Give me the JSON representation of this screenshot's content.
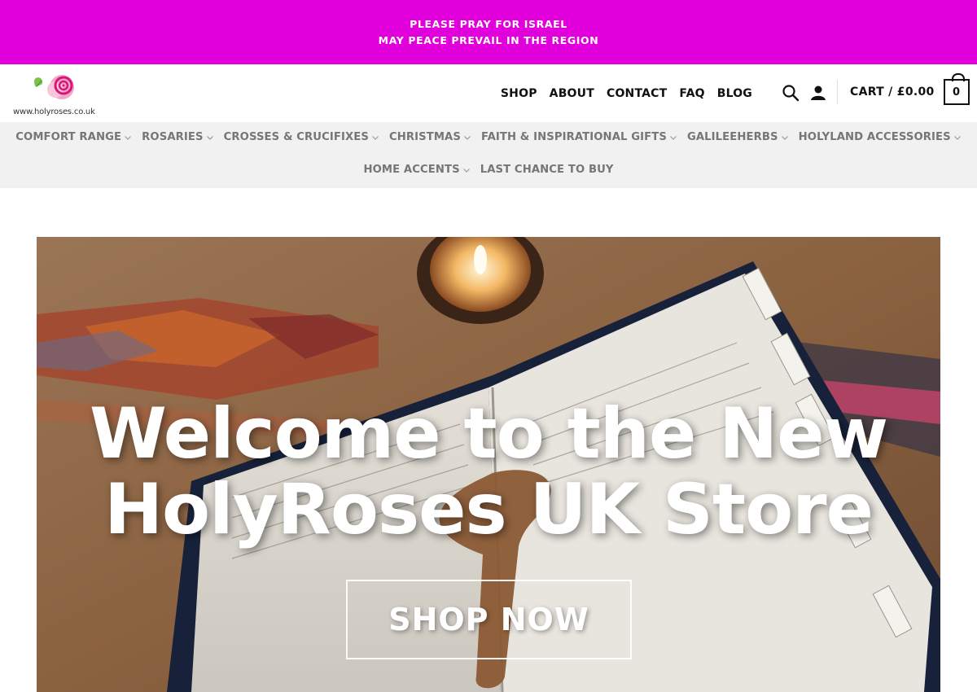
{
  "announcement": {
    "line1": "PLEASE PRAY FOR ISRAEL",
    "line2": "MAY PEACE PREVAIL IN THE REGION"
  },
  "logo": {
    "url_text": "www.holyroses.co.uk"
  },
  "main_nav": [
    {
      "label": "SHOP"
    },
    {
      "label": "ABOUT"
    },
    {
      "label": "CONTACT"
    },
    {
      "label": "FAQ"
    },
    {
      "label": "BLOG"
    }
  ],
  "header_icons": [
    "search-icon",
    "user-icon"
  ],
  "cart": {
    "label": "CART / £0.00",
    "count": "0"
  },
  "category_nav": {
    "row1": [
      {
        "label": "COMFORT RANGE"
      },
      {
        "label": "ROSARIES"
      },
      {
        "label": "CROSSES & CRUCIFIXES"
      },
      {
        "label": "CHRISTMAS"
      },
      {
        "label": "FAITH & INSPIRATIONAL GIFTS"
      },
      {
        "label": "GALILEEHERBS"
      },
      {
        "label": "HOLYLAND ACCESSORIES"
      }
    ],
    "row2": [
      {
        "label": "HOME ACCENTS",
        "dropdown": true
      },
      {
        "label": "LAST CHANCE TO BUY",
        "dropdown": false
      }
    ]
  },
  "hero": {
    "title_line1": "Welcome to the New",
    "title_line2": "HolyRoses UK Store",
    "cta_label": "SHOP NOW"
  },
  "colors": {
    "announcement_bg": "#e100dc",
    "category_bg": "#f1f1f1",
    "category_text": "#767676",
    "nav_text": "#111111"
  }
}
